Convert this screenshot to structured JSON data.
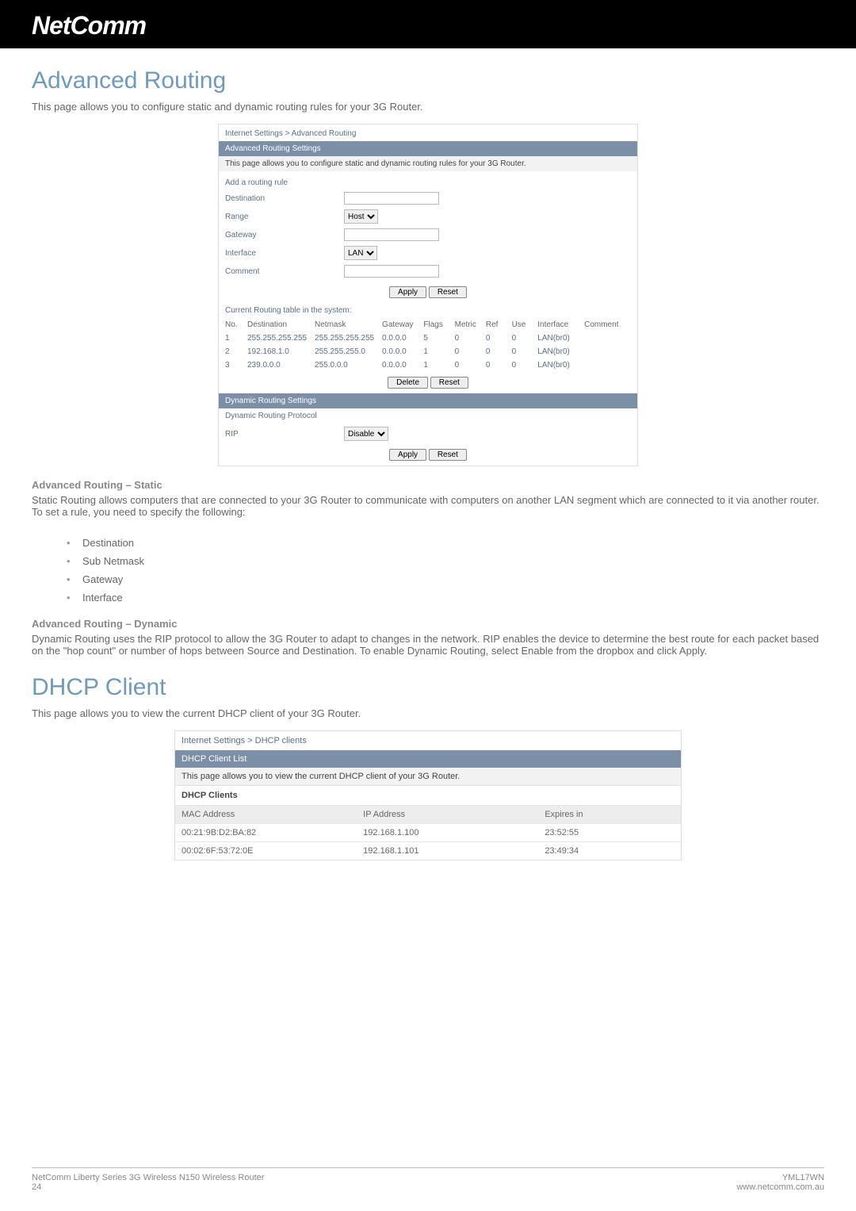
{
  "brand": "NetComm",
  "adv_routing": {
    "heading": "Advanced Routing",
    "lead": "This page allows you to configure static and dynamic routing rules for your 3G Router.",
    "crumb": "Internet Settings > Advanced Routing",
    "bar": "Advanced Routing Settings",
    "desc": "This page allows you to configure static and dynamic routing rules for your 3G Router.",
    "form": {
      "add_rule": "Add a routing rule",
      "destination": "Destination",
      "range": "Range",
      "gateway": "Gateway",
      "interface": "Interface",
      "comment": "Comment",
      "range_sel": "Host",
      "iface_sel": "LAN",
      "apply": "Apply",
      "reset": "Reset"
    },
    "table": {
      "caption": "Current Routing table in the system:",
      "headers": {
        "no": "No.",
        "dest": "Destination",
        "mask": "Netmask",
        "gw": "Gateway",
        "flags": "Flags",
        "metric": "Metric",
        "ref": "Ref",
        "use": "Use",
        "iface": "Interface",
        "comment": "Comment"
      },
      "rows": [
        {
          "no": "1",
          "dest": "255.255.255.255",
          "mask": "255.255.255.255",
          "gw": "0.0.0.0",
          "flags": "5",
          "metric": "0",
          "ref": "0",
          "use": "0",
          "iface": "LAN(br0)",
          "comment": ""
        },
        {
          "no": "2",
          "dest": "192.168.1.0",
          "mask": "255.255.255.0",
          "gw": "0.0.0.0",
          "flags": "1",
          "metric": "0",
          "ref": "0",
          "use": "0",
          "iface": "LAN(br0)",
          "comment": ""
        },
        {
          "no": "3",
          "dest": "239.0.0.0",
          "mask": "255.0.0.0",
          "gw": "0.0.0.0",
          "flags": "1",
          "metric": "0",
          "ref": "0",
          "use": "0",
          "iface": "LAN(br0)",
          "comment": ""
        }
      ],
      "delete": "Delete",
      "reset": "Reset"
    },
    "dyn": {
      "bar": "Dynamic Routing Settings",
      "proto_label": "Dynamic Routing Protocol",
      "rip": "RIP",
      "sel": "Disable",
      "apply": "Apply",
      "reset": "Reset"
    }
  },
  "static_section": {
    "heading": "Advanced Routing – Static",
    "p": "Static Routing allows computers that are connected to your 3G Router to communicate with computers on another LAN segment which are connected to it via another router. To set a rule, you need to specify the following:",
    "bullets": [
      "Destination",
      "Sub Netmask",
      "Gateway",
      "Interface"
    ]
  },
  "dynamic_section": {
    "heading": "Advanced Routing – Dynamic",
    "p": "Dynamic Routing uses the RIP protocol to allow the 3G Router to adapt to changes in the network. RIP enables the device to determine the best route for each packet based on the \"hop count\" or number of hops between Source and Destination. To enable Dynamic Routing, select Enable from the dropbox and click Apply."
  },
  "dhcp": {
    "heading": "DHCP Client",
    "lead": "This page allows you to view the current DHCP client of your 3G Router.",
    "crumb": "Internet Settings > DHCP clients",
    "bar": "DHCP Client List",
    "desc": "This page allows you to view the current DHCP client of your 3G Router.",
    "section": "DHCP Clients",
    "headers": {
      "mac": "MAC Address",
      "ip": "IP Address",
      "exp": "Expires in"
    },
    "rows": [
      {
        "mac": "00:21:9B:D2:BA:82",
        "ip": "192.168.1.100",
        "exp": "23:52:55"
      },
      {
        "mac": "00:02:6F:53:72:0E",
        "ip": "192.168.1.101",
        "exp": "23:49:34"
      }
    ]
  },
  "footer": {
    "left1": "NetComm Liberty Series 3G Wireless N150 Wireless Router",
    "left2": "24",
    "right1": "YML17WN",
    "right2": "www.netcomm.com.au"
  }
}
